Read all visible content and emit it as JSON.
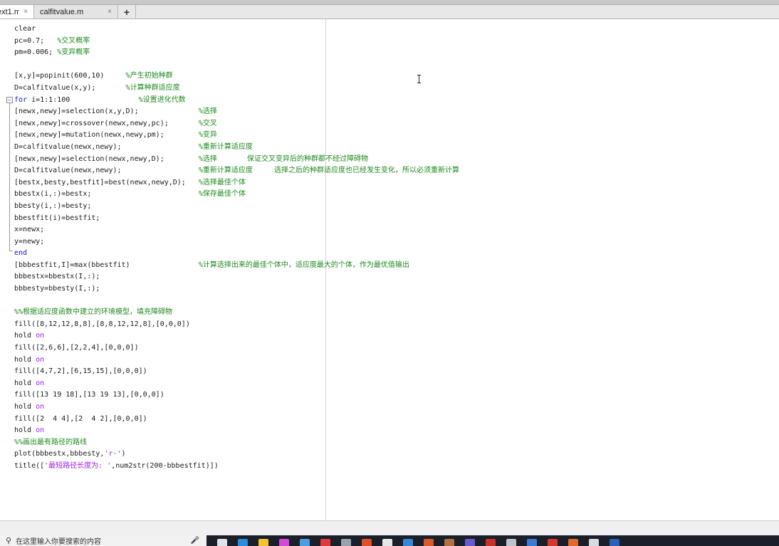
{
  "tabs": [
    {
      "label": "ext1.m",
      "close_icon": "×",
      "active": true
    },
    {
      "label": "calfitvalue.m",
      "close_icon": "×",
      "active": false
    }
  ],
  "add_tab_label": "+",
  "fold_marker": "−",
  "code_lines": [
    [
      {
        "t": "clear",
        "c": "code"
      }
    ],
    [
      {
        "t": "pc=0.7;   ",
        "c": "code"
      },
      {
        "t": "%交叉概率",
        "c": "comment"
      }
    ],
    [
      {
        "t": "pm=0.006; ",
        "c": "code"
      },
      {
        "t": "%变异概率",
        "c": "comment"
      }
    ],
    [],
    [
      {
        "t": "[x,y]=popinit(600,10)     ",
        "c": "code"
      },
      {
        "t": "%产生初始种群",
        "c": "comment"
      }
    ],
    [
      {
        "t": "D=calfitvalue(x,y);       ",
        "c": "code"
      },
      {
        "t": "%计算种群适应度",
        "c": "comment"
      }
    ],
    [
      {
        "t": "for",
        "c": "kw"
      },
      {
        "t": " i=1:1:100                ",
        "c": "code"
      },
      {
        "t": "%设置进化代数",
        "c": "comment"
      }
    ],
    [
      {
        "t": "[newx,newy]=selection(x,y,D);              ",
        "c": "code"
      },
      {
        "t": "%选择",
        "c": "comment"
      }
    ],
    [
      {
        "t": "[newx,newy]=crossover(newx,newy,pc);       ",
        "c": "code"
      },
      {
        "t": "%交叉",
        "c": "comment"
      }
    ],
    [
      {
        "t": "[newx,newy]=mutation(newx,newy,pm);        ",
        "c": "code"
      },
      {
        "t": "%变异",
        "c": "comment"
      }
    ],
    [
      {
        "t": "D=calfitvalue(newx,newy);                  ",
        "c": "code"
      },
      {
        "t": "%重新计算适应度",
        "c": "comment"
      }
    ],
    [
      {
        "t": "[newx,newy]=selection(newx,newy,D);        ",
        "c": "code"
      },
      {
        "t": "%选择       保证交叉变异后的种群都不经过障碍物",
        "c": "comment"
      }
    ],
    [
      {
        "t": "D=calfitvalue(newx,newy);                  ",
        "c": "code"
      },
      {
        "t": "%重新计算适应度     选择之后的种群适应度也已经发生变化，所以必须重新计算",
        "c": "comment"
      }
    ],
    [
      {
        "t": "[bestx,besty,bestfit]=best(newx,newy,D);   ",
        "c": "code"
      },
      {
        "t": "%选择最佳个体",
        "c": "comment"
      }
    ],
    [
      {
        "t": "bbestx(i,:)=bestx;                         ",
        "c": "code"
      },
      {
        "t": "%保存最佳个体",
        "c": "comment"
      }
    ],
    [
      {
        "t": "bbesty(i,:)=besty;",
        "c": "code"
      }
    ],
    [
      {
        "t": "bbestfit(i)=bestfit;",
        "c": "code"
      }
    ],
    [
      {
        "t": "x=newx;",
        "c": "code"
      }
    ],
    [
      {
        "t": "y=newy;",
        "c": "code"
      }
    ],
    [
      {
        "t": "end",
        "c": "kw"
      }
    ],
    [
      {
        "t": "[bbbestfit,I]=max(bbestfit)                ",
        "c": "code"
      },
      {
        "t": "%计算选择出来的最佳个体中，适应度最大的个体，作为最优值输出",
        "c": "comment"
      }
    ],
    [
      {
        "t": "bbbestx=bbestx(I,:);",
        "c": "code"
      }
    ],
    [
      {
        "t": "bbbesty=bbesty(I,:);",
        "c": "code"
      }
    ],
    [],
    [
      {
        "t": "%%根据适应度函数中建立的环境模型，填充障碍物",
        "c": "comment"
      }
    ],
    [
      {
        "t": "fill([8,12,12,8,8],[8,8,12,12,8],[0,0,0])",
        "c": "code"
      }
    ],
    [
      {
        "t": "hold ",
        "c": "code"
      },
      {
        "t": "on",
        "c": "on"
      }
    ],
    [
      {
        "t": "fill([2,6,6],[2,2,4],[0,0,0])",
        "c": "code"
      }
    ],
    [
      {
        "t": "hold ",
        "c": "code"
      },
      {
        "t": "on",
        "c": "on"
      }
    ],
    [
      {
        "t": "fill([4,7,2],[6,15,15],[0,0,0])",
        "c": "code"
      }
    ],
    [
      {
        "t": "hold ",
        "c": "code"
      },
      {
        "t": "on",
        "c": "on"
      }
    ],
    [
      {
        "t": "fill([13 19 18],[13 19 13],[0,0,0])",
        "c": "code"
      }
    ],
    [
      {
        "t": "hold ",
        "c": "code"
      },
      {
        "t": "on",
        "c": "on"
      }
    ],
    [
      {
        "t": "fill([2  4 4],[2  4 2],[0,0,0])",
        "c": "code"
      }
    ],
    [
      {
        "t": "hold ",
        "c": "code"
      },
      {
        "t": "on",
        "c": "on"
      }
    ],
    [
      {
        "t": "%%画出最有路径的路线",
        "c": "comment"
      }
    ],
    [
      {
        "t": "plot(bbbestx,bbbesty,",
        "c": "code"
      },
      {
        "t": "'r-'",
        "c": "string"
      },
      {
        "t": ")",
        "c": "code"
      }
    ],
    [
      {
        "t": "title([",
        "c": "code"
      },
      {
        "t": "'最短路径长度为: '",
        "c": "string"
      },
      {
        "t": ",num2str(200-bbbestfit)])",
        "c": "code"
      }
    ]
  ],
  "colors": {
    "code": "#1a1a1a",
    "keyword": "#1414d6",
    "comment": "#1f8a1f",
    "string": "#a020f0"
  },
  "taskbar": {
    "search_placeholder": "在这里输入你要搜索的内容",
    "search_icon": "search-icon",
    "mic_icon": "microphone-icon",
    "app_icons": [
      {
        "name": "task-view-icon",
        "color": "#dfe4ea"
      },
      {
        "name": "edge-icon",
        "color": "#2a8be0"
      },
      {
        "name": "file-explorer-icon",
        "color": "#f2c230"
      },
      {
        "name": "store-icon",
        "color": "#d24ad8"
      },
      {
        "name": "chrome-icon",
        "color": "#4b9ee0"
      },
      {
        "name": "app-icon-red",
        "color": "#e23a3a"
      },
      {
        "name": "app-icon-gray",
        "color": "#9aa3ad"
      },
      {
        "name": "app-icon-orange",
        "color": "#e0502a"
      },
      {
        "name": "calculator-icon",
        "color": "#e6e6e6"
      },
      {
        "name": "network-icon",
        "color": "#3a86d6"
      },
      {
        "name": "matlab-icon",
        "color": "#d65a2a"
      },
      {
        "name": "app-icon-brown",
        "color": "#b07040"
      },
      {
        "name": "app-icon-violet",
        "color": "#6a5acd"
      },
      {
        "name": "pdf-icon",
        "color": "#c8322a"
      },
      {
        "name": "app-icon-gray2",
        "color": "#c0c4c8"
      },
      {
        "name": "app-icon-blue",
        "color": "#3a7bd5"
      },
      {
        "name": "app-icon-red2",
        "color": "#d4382a"
      },
      {
        "name": "matlab-running-icon",
        "color": "#e06a2a"
      },
      {
        "name": "app-icon-white",
        "color": "#d8dce0"
      },
      {
        "name": "word-icon",
        "color": "#2b5fb8"
      }
    ]
  }
}
